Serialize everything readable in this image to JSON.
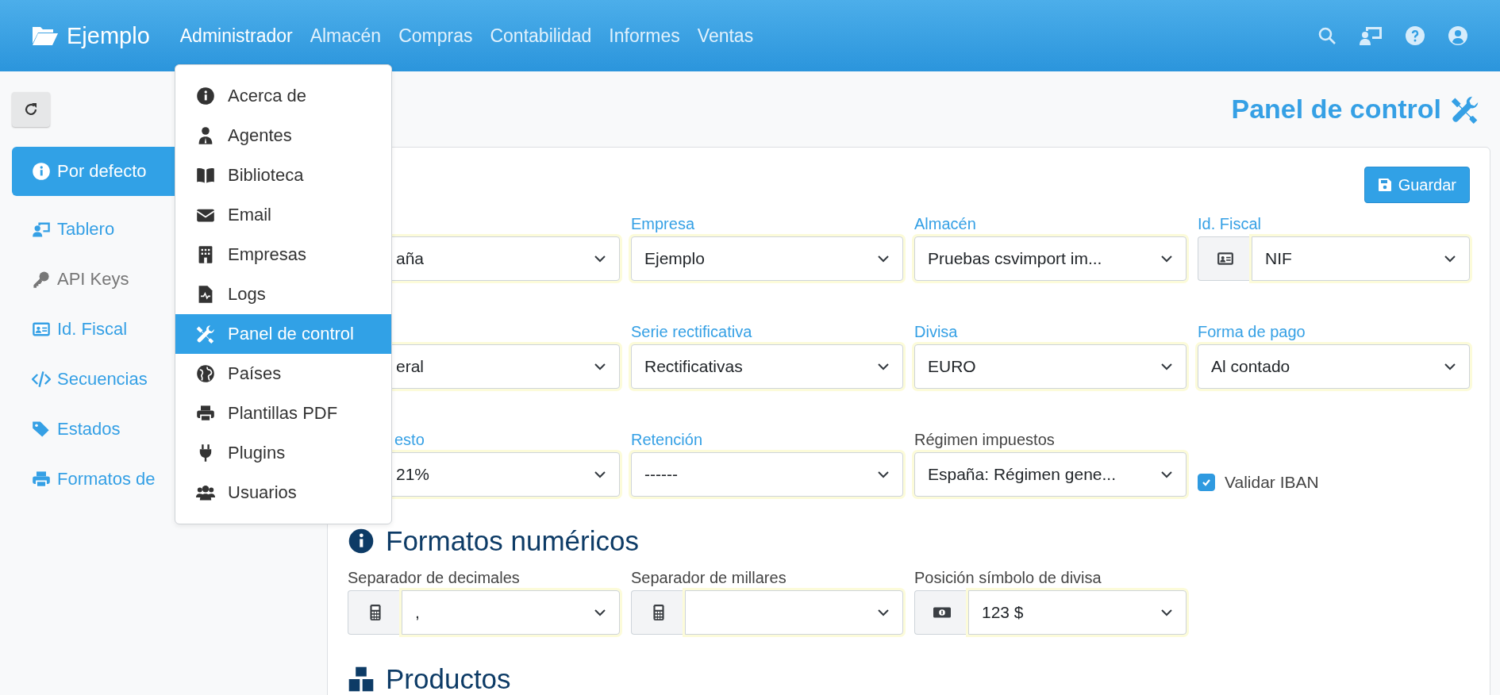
{
  "brand": {
    "name": "Ejemplo"
  },
  "nav": [
    {
      "label": "Administrador",
      "selected": true
    },
    {
      "label": "Almacén",
      "selected": false
    },
    {
      "label": "Compras",
      "selected": false
    },
    {
      "label": "Contabilidad",
      "selected": false
    },
    {
      "label": "Informes",
      "selected": false
    },
    {
      "label": "Ventas",
      "selected": false
    }
  ],
  "sidebar": {
    "items": [
      {
        "label": "Por defecto",
        "selected": true,
        "disabled": false
      },
      {
        "label": "Tablero",
        "selected": false,
        "disabled": false
      },
      {
        "label": "API Keys",
        "selected": false,
        "disabled": true
      },
      {
        "label": "Id. Fiscal",
        "selected": false,
        "disabled": false
      },
      {
        "label": "Secuencias",
        "selected": false,
        "disabled": false
      },
      {
        "label": "Estados",
        "selected": false,
        "disabled": false
      },
      {
        "label": "Formatos de",
        "selected": false,
        "disabled": false
      }
    ]
  },
  "page_title": "Panel de control",
  "save_button": "Guardar",
  "fields": [
    {
      "kind": "select",
      "value": "aña"
    },
    {
      "kind": "select",
      "label": "Empresa",
      "required": true,
      "value": "Ejemplo"
    },
    {
      "kind": "select",
      "label": "Almacén",
      "required": true,
      "value": "Pruebas csvimport im..."
    },
    {
      "kind": "addon-select",
      "label": "Id. Fiscal",
      "required": true,
      "value": "NIF"
    },
    {
      "kind": "select",
      "value": "eral"
    },
    {
      "kind": "select",
      "label": "Serie rectificativa",
      "required": true,
      "value": "Rectificativas"
    },
    {
      "kind": "select",
      "label": "Divisa",
      "required": true,
      "value": "EURO"
    },
    {
      "kind": "select",
      "label": "Forma de pago",
      "required": true,
      "value": "Al contado"
    },
    {
      "kind": "select",
      "label": "esto",
      "required": true,
      "value": "21%"
    },
    {
      "kind": "select",
      "label": "Retención",
      "required": true,
      "value": "------"
    },
    {
      "kind": "select",
      "label": "Régimen impuestos",
      "required": false,
      "value": "España: Régimen gene..."
    },
    {
      "kind": "checkbox",
      "label": "Validar IBAN",
      "checked": true
    }
  ],
  "sections": [
    {
      "title": "Formatos numéricos",
      "fields": [
        {
          "kind": "addon-select",
          "label": "Separador de decimales",
          "required": false,
          "value": ","
        },
        {
          "kind": "addon-select",
          "label": "Separador de millares",
          "required": false
        },
        {
          "kind": "addon-select",
          "label": "Posición símbolo de divisa",
          "required": false,
          "value": "123 $"
        }
      ]
    },
    {
      "title": "Productos"
    }
  ],
  "menu": {
    "items": [
      {
        "label": "Acerca de",
        "selected": false
      },
      {
        "label": "Agentes",
        "selected": false
      },
      {
        "label": "Biblioteca",
        "selected": false
      },
      {
        "label": "Email",
        "selected": false
      },
      {
        "label": "Empresas",
        "selected": false
      },
      {
        "label": "Logs",
        "selected": false
      },
      {
        "label": "Panel de control",
        "selected": true
      },
      {
        "label": "Países",
        "selected": false
      },
      {
        "label": "Plantillas PDF",
        "selected": false
      },
      {
        "label": "Plugins",
        "selected": false
      },
      {
        "label": "Usuarios",
        "selected": false
      }
    ]
  }
}
